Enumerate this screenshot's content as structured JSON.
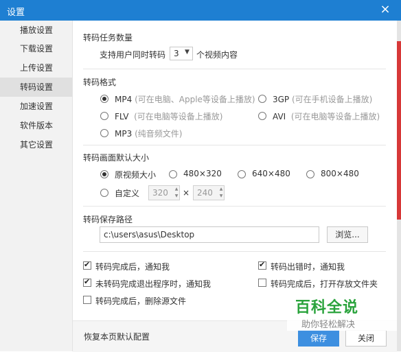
{
  "window": {
    "title": "设置",
    "close_glyph": "×"
  },
  "sidebar": {
    "items": [
      {
        "label": "播放设置"
      },
      {
        "label": "下载设置"
      },
      {
        "label": "上传设置"
      },
      {
        "label": "转码设置",
        "active": true
      },
      {
        "label": "加速设置"
      },
      {
        "label": "软件版本"
      },
      {
        "label": "其它设置"
      }
    ]
  },
  "task_count": {
    "title": "转码任务数量",
    "prefix": "支持用户同时转码",
    "value": "3",
    "suffix": "个视频内容"
  },
  "format": {
    "title": "转码格式",
    "options": [
      {
        "label": "MP4",
        "hint": "(可在电脑、Apple等设备上播放)",
        "checked": true
      },
      {
        "label": "3GP",
        "hint": "(可在手机设备上播放)",
        "checked": false
      },
      {
        "label": "FLV",
        "hint": "(可在电脑等设备上播放)",
        "checked": false
      },
      {
        "label": "AVI",
        "hint": "(可在电脑等设备上播放)",
        "checked": false
      },
      {
        "label": "MP3",
        "hint": "(纯音频文件)",
        "checked": false
      }
    ]
  },
  "size": {
    "title": "转码画面默认大小",
    "options": [
      {
        "label": "原视频大小",
        "checked": true
      },
      {
        "label": "480×320",
        "checked": false
      },
      {
        "label": "640×480",
        "checked": false
      },
      {
        "label": "800×480",
        "checked": false
      },
      {
        "label": "自定义",
        "checked": false
      }
    ],
    "custom_width": "320",
    "custom_height": "240",
    "times": "×"
  },
  "save_path": {
    "title": "转码保存路径",
    "value": "c:\\users\\asus\\Desktop",
    "browse_label": "浏览..."
  },
  "options": [
    {
      "label": "转码完成后，通知我",
      "checked": true
    },
    {
      "label": "转码出错时，通知我",
      "checked": true
    },
    {
      "label": "未转码完成退出程序时，通知我",
      "checked": true
    },
    {
      "label": "转码完成后，打开存放文件夹",
      "checked": false
    },
    {
      "label": "转码完成后，删除源文件",
      "checked": false
    }
  ],
  "footer": {
    "reset_label": "恢复本页默认配置",
    "save_label": "保存",
    "close_label": "关闭"
  },
  "watermark": {
    "main": "百科全说",
    "sub": "助你轻松解决"
  },
  "colors": {
    "titlebar": "#1e7fd2",
    "primary_button": "#3d8fe0",
    "watermark": "#2aa33c"
  }
}
